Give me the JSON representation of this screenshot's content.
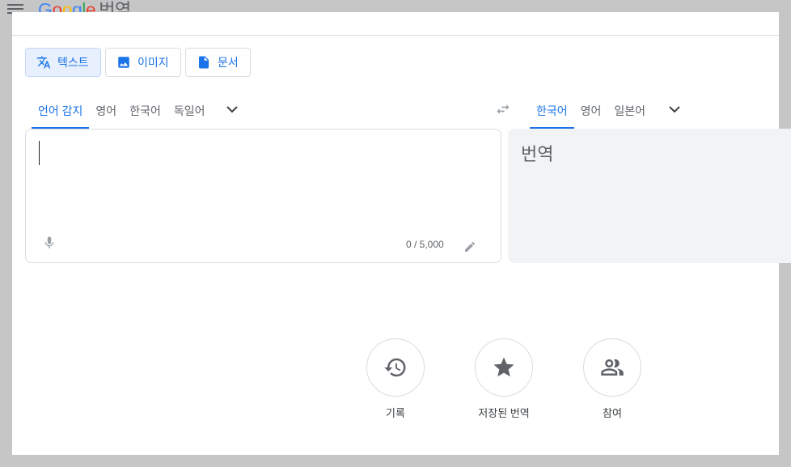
{
  "header": {
    "menu_icon": "hamburger-menu-icon",
    "brand": {
      "g1": "G",
      "o1": "o",
      "o2": "o",
      "g2": "g",
      "l": "l",
      "e": "e"
    },
    "product_name": "번역"
  },
  "modes": [
    {
      "label": "텍스트",
      "icon": "translate-icon",
      "active": true
    },
    {
      "label": "이미지",
      "icon": "image-icon",
      "active": false
    },
    {
      "label": "문서",
      "icon": "document-icon",
      "active": false
    }
  ],
  "source_langs": [
    "언어 감지",
    "영어",
    "한국어",
    "독일어"
  ],
  "target_langs": [
    "한국어",
    "영어",
    "일본어"
  ],
  "source": {
    "value": "",
    "char_count": "0 / 5,000"
  },
  "target": {
    "placeholder": "번역"
  },
  "actions": [
    {
      "label": "기록",
      "icon": "history-icon"
    },
    {
      "label": "저장된 번역",
      "icon": "star-icon"
    },
    {
      "label": "참여",
      "icon": "people-icon"
    }
  ],
  "colors": {
    "accent": "#1a73e8",
    "overlay": "#c6c6c6"
  }
}
